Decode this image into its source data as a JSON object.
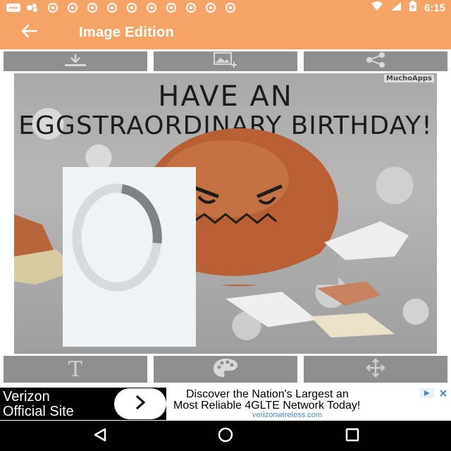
{
  "status_bar": {
    "time": "6:15"
  },
  "app_bar": {
    "title": "Image Edition"
  },
  "toolbar_top": [
    {
      "icon": "download-icon"
    },
    {
      "icon": "add-image-icon"
    },
    {
      "icon": "share-icon"
    }
  ],
  "image": {
    "watermark": "MuchoApps",
    "headline_line1": "HAVE AN",
    "headline_line2": "EGGSTRAORDINARY BIRTHDAY!"
  },
  "toolbar_bottom": [
    {
      "icon": "text-icon",
      "glyph": "T"
    },
    {
      "icon": "palette-icon"
    },
    {
      "icon": "move-icon"
    }
  ],
  "ad": {
    "left_line1": "Verizon",
    "left_line2": "Official Site",
    "headline_line1": "Discover the Nation's Largest an",
    "headline_line2": "Most Reliable 4GLTE Network Today!",
    "url": "verizonwireless.com"
  },
  "colors": {
    "accent": "#f5a366",
    "toolbar_button": "#8f8f8f",
    "nav_bar": "#000000"
  }
}
